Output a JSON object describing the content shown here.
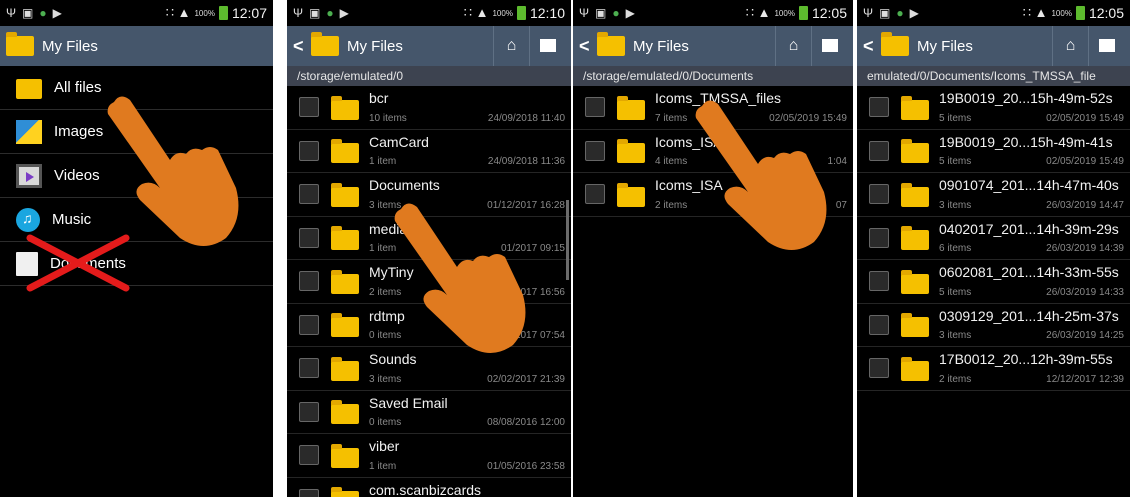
{
  "status": {
    "battery_pct": "100%",
    "times": [
      "12:07",
      "12:10",
      "12:05",
      "12:05"
    ]
  },
  "app_title": "My Files",
  "panel1": {
    "menu": [
      {
        "label": "All files",
        "icon": "folder-icon"
      },
      {
        "label": "Images",
        "icon": "images-icon"
      },
      {
        "label": "Videos",
        "icon": "videos-icon"
      },
      {
        "label": "Music",
        "icon": "music-icon"
      },
      {
        "label": "Documents",
        "icon": "documents-icon"
      }
    ]
  },
  "panel2": {
    "path": "/storage/emulated/0",
    "rows": [
      {
        "name": "bcr",
        "count": "10 items",
        "date": "24/09/2018 11:40"
      },
      {
        "name": "CamCard",
        "count": "1 item",
        "date": "24/09/2018 11:36"
      },
      {
        "name": "Documents",
        "count": "3 items",
        "date": "01/12/2017 16:28"
      },
      {
        "name": "media",
        "count": "1 item",
        "date": "01/2017 09:15"
      },
      {
        "name": "MyTiny",
        "count": "2 items",
        "date": "2017 16:56"
      },
      {
        "name": "rdtmp",
        "count": "0 items",
        "date": "2017 07:54"
      },
      {
        "name": "Sounds",
        "count": "3 items",
        "date": "02/02/2017 21:39"
      },
      {
        "name": "Saved Email",
        "count": "0 items",
        "date": "08/08/2016 12:00"
      },
      {
        "name": "viber",
        "count": "1 item",
        "date": "01/05/2016 23:58"
      },
      {
        "name": "com.scanbizcards",
        "count": "",
        "date": ""
      }
    ]
  },
  "panel3": {
    "path": "/storage/emulated/0/Documents",
    "rows": [
      {
        "name": "Icoms_TMSSA_files",
        "count": "7 items",
        "date": "02/05/2019 15:49"
      },
      {
        "name": "Icoms_ISA",
        "count": "4 items",
        "date": "1:04"
      },
      {
        "name": "Icoms_ISA",
        "count": "2 items",
        "date": "07"
      }
    ]
  },
  "panel4": {
    "path": "emulated/0/Documents/Icoms_TMSSA_file",
    "rows": [
      {
        "name": "19B0019_20...15h-49m-52s",
        "count": "5 items",
        "date": "02/05/2019 15:49"
      },
      {
        "name": "19B0019_20...15h-49m-41s",
        "count": "5 items",
        "date": "02/05/2019 15:49"
      },
      {
        "name": "0901074_201...14h-47m-40s",
        "count": "3 items",
        "date": "26/03/2019 14:47"
      },
      {
        "name": "0402017_201...14h-39m-29s",
        "count": "6 items",
        "date": "26/03/2019 14:39"
      },
      {
        "name": "0602081_201...14h-33m-55s",
        "count": "5 items",
        "date": "26/03/2019 14:33"
      },
      {
        "name": "0309129_201...14h-25m-37s",
        "count": "3 items",
        "date": "26/03/2019 14:25"
      },
      {
        "name": "17B0012_20...12h-39m-55s",
        "count": "2 items",
        "date": "12/12/2017 12:39"
      }
    ]
  },
  "colors": {
    "appbar": "#45566b",
    "pathbar": "#3d4350",
    "folder": "#f5c000",
    "hand": "#e07a1f",
    "cross": "#e41b1b"
  }
}
